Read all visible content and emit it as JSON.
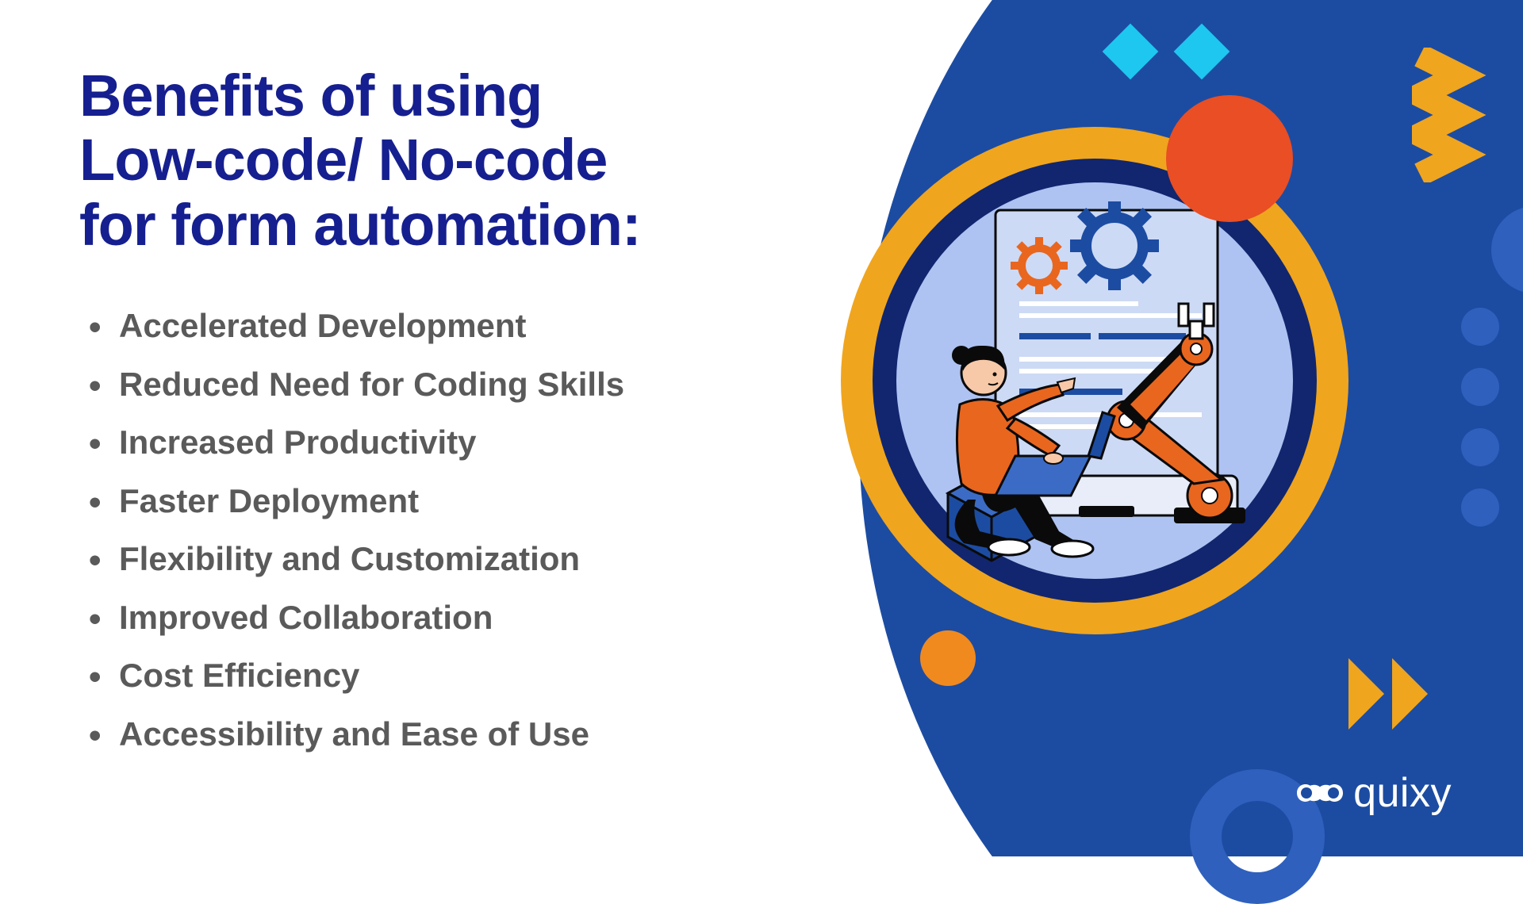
{
  "heading": {
    "line1": "Benefits of using",
    "line2": "Low-code/ No-code",
    "line3": "for form automation:"
  },
  "benefits": [
    "Accelerated Development",
    "Reduced Need for Coding Skills",
    "Increased Productivity",
    "Faster Deployment",
    "Flexibility and Customization",
    "Improved Collaboration",
    "Cost Efficiency",
    "Accessibility and Ease of Use"
  ],
  "brand": "quixy",
  "colors": {
    "bgblue": "#1c4ca2",
    "headingBlue": "#161f8f",
    "orange": "#e94e24",
    "gold": "#f0a51e",
    "cyan": "#1ec7f0",
    "navy": "#11266e",
    "lightblue": "#aec3f2",
    "blue3": "#2f60bd",
    "textgray": "#5a5a5a"
  }
}
